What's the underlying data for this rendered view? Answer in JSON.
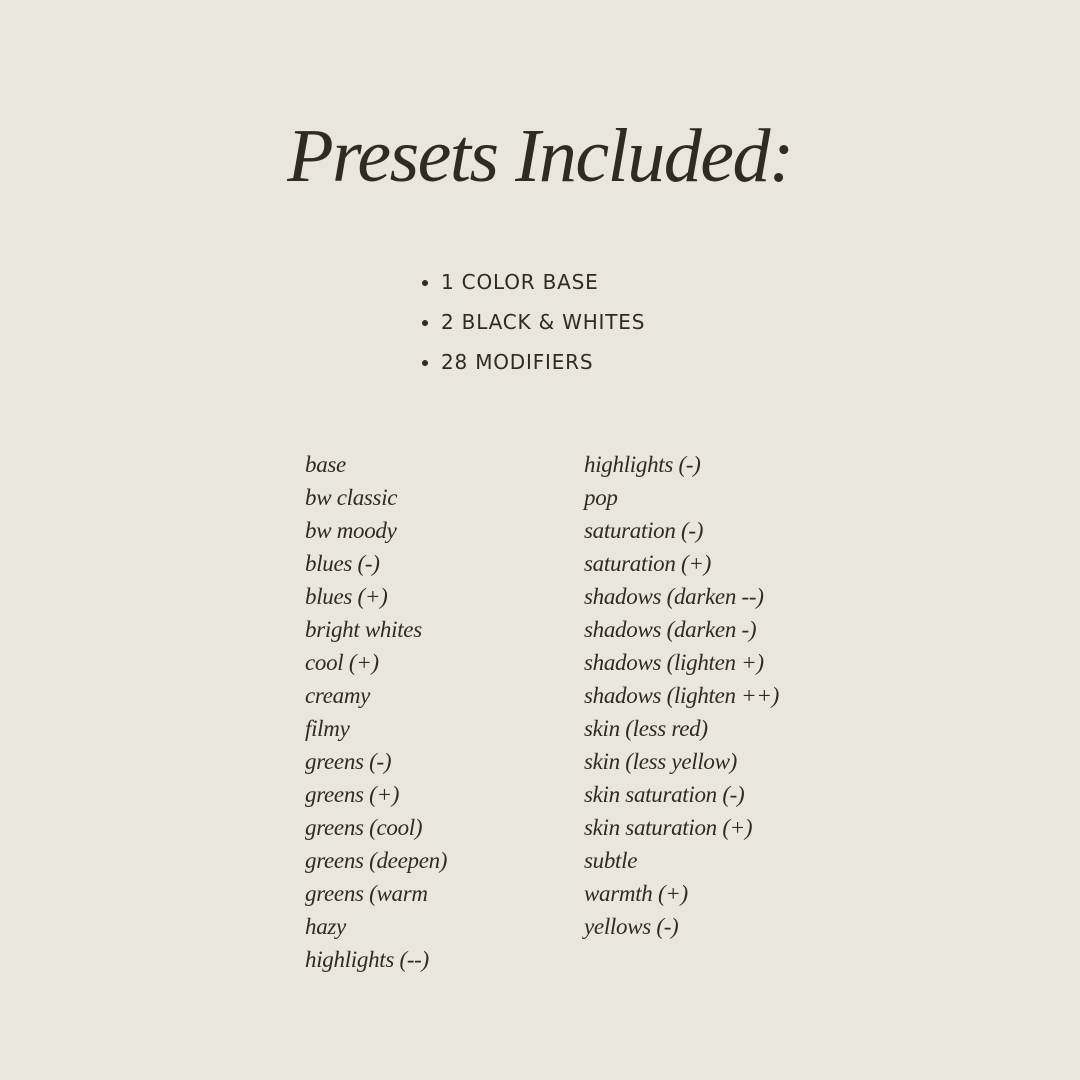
{
  "title": "Presets Included:",
  "summary": [
    {
      "text": "1 COLOR BASE"
    },
    {
      "text": "2 BLACK & WHITES"
    },
    {
      "text": "28 MODIFIERS"
    }
  ],
  "presets": {
    "left": [
      "base",
      "bw classic",
      "bw moody",
      "blues (-)",
      "blues (+)",
      "bright whites",
      "cool (+)",
      "creamy",
      "filmy",
      "greens (-)",
      "greens (+)",
      "greens (cool)",
      "greens (deepen)",
      "greens (warm",
      "hazy",
      "highlights (--)"
    ],
    "right": [
      "highlights (-)",
      "pop",
      "saturation (-)",
      "saturation (+)",
      "shadows (darken --)",
      "shadows (darken -)",
      "shadows (lighten +)",
      "shadows (lighten ++)",
      "skin (less red)",
      "skin (less yellow)",
      "skin saturation (-)",
      "skin saturation (+)",
      "subtle",
      "warmth (+)",
      "yellows (-)"
    ]
  },
  "colors": {
    "background": "#e9e6de",
    "text": "#2f2a22"
  }
}
